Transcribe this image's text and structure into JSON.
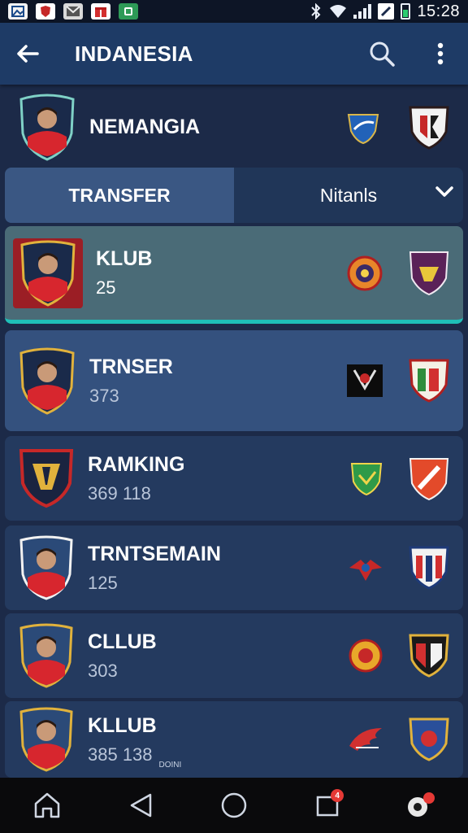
{
  "status_bar": {
    "time": "15:28",
    "notification_icons": [
      "image-icon",
      "shield-icon",
      "mail-icon",
      "gift-icon",
      "app-icon"
    ]
  },
  "app_bar": {
    "title": "INDANESIA",
    "back_icon": "arrow-left-icon",
    "search_icon": "search-icon",
    "menu_icon": "more-vert-icon"
  },
  "header": {
    "name": "NEMANGIA"
  },
  "tabs": [
    {
      "label": "TRANSFER",
      "active": true
    },
    {
      "label": "Nitanls",
      "active": false
    }
  ],
  "rows": [
    {
      "title": "KLUB",
      "sub": "25",
      "note": ""
    },
    {
      "title": "TRNSER",
      "sub": "373",
      "note": ""
    },
    {
      "title": "RAMKING",
      "sub": "369  118",
      "note": ""
    },
    {
      "title": "TRNTSEMAIN",
      "sub": "125",
      "note": ""
    },
    {
      "title": "CLLUB",
      "sub": "303",
      "note": ""
    },
    {
      "title": "KLLUB",
      "sub": "385  138",
      "note": "DOINI"
    }
  ],
  "bottom_nav": {
    "badge": "4"
  },
  "colors": {
    "background": "#1c2a48",
    "app_bar": "#1e3b66",
    "selected_row": "#4a6b77",
    "accent_teal": "#1fbfb8",
    "jersey_red": "#d7262e"
  }
}
